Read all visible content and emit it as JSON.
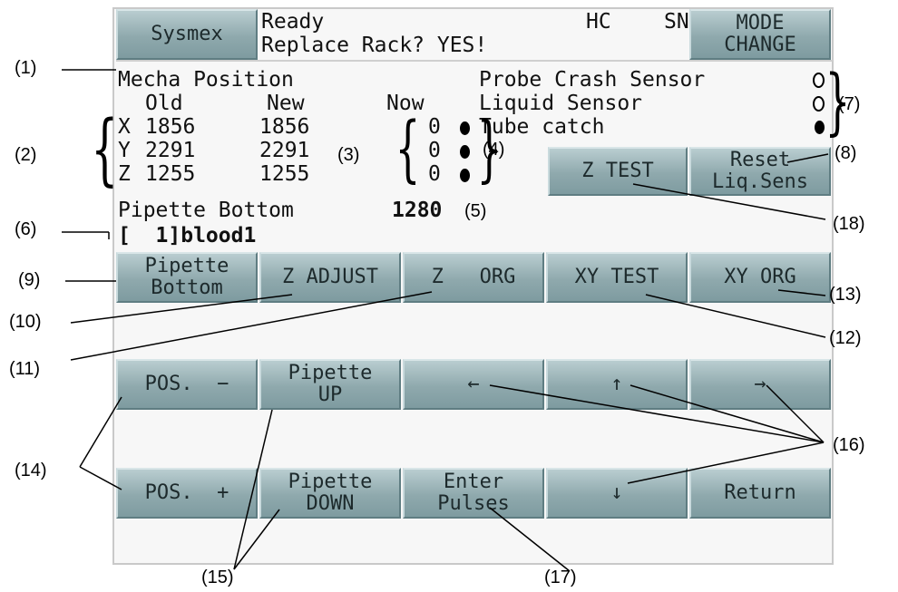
{
  "header": {
    "brand_button": "Sysmex",
    "status_line1": "Ready",
    "status_line2": "Replace Rack? YES!",
    "hc": "HC",
    "sn": "SN",
    "mode_change_line1": "MODE",
    "mode_change_line2": "CHANGE"
  },
  "info": {
    "title": "Mecha Position",
    "col_old": "Old",
    "col_new": "New",
    "col_now": "Now",
    "rows": [
      {
        "axis": "X",
        "old": "1856",
        "new": "1856",
        "now": "0"
      },
      {
        "axis": "Y",
        "old": "2291",
        "new": "2291",
        "now": "0"
      },
      {
        "axis": "Z",
        "old": "1255",
        "new": "1255",
        "now": "0"
      }
    ],
    "sensors": [
      {
        "label": "Probe Crash Sensor",
        "state": "off"
      },
      {
        "label": "Liquid Sensor",
        "state": "off"
      },
      {
        "label": "Tube catch",
        "state": "on"
      }
    ],
    "pipette_bottom_label": "Pipette Bottom",
    "pipette_bottom_value": "1280",
    "sample_label": "[  1]blood1"
  },
  "buttons": {
    "z_test": "Z TEST",
    "reset_liq_line1": "Reset",
    "reset_liq_line2": "Liq.Sens",
    "row1": [
      {
        "line1": "Pipette",
        "line2": "Bottom"
      },
      {
        "line1": "Z ADJUST",
        "line2": ""
      },
      {
        "line1": "Z   ORG",
        "line2": ""
      },
      {
        "line1": "XY TEST",
        "line2": ""
      },
      {
        "line1": "XY ORG",
        "line2": ""
      }
    ],
    "row2": [
      {
        "line1": "POS.  −",
        "line2": ""
      },
      {
        "line1": "Pipette",
        "line2": "UP"
      },
      {
        "line1": "←",
        "line2": ""
      },
      {
        "line1": "↑",
        "line2": ""
      },
      {
        "line1": "→",
        "line2": ""
      }
    ],
    "row3": [
      {
        "line1": "POS.  +",
        "line2": ""
      },
      {
        "line1": "Pipette",
        "line2": "DOWN"
      },
      {
        "line1": "Enter",
        "line2": "Pulses"
      },
      {
        "line1": "↓",
        "line2": ""
      },
      {
        "line1": "Return",
        "line2": ""
      }
    ]
  },
  "callouts": [
    "(1)",
    "(2)",
    "(3)",
    "(4)",
    "(5)",
    "(6)",
    "(7)",
    "(8)",
    "(9)",
    "(10)",
    "(11)",
    "(12)",
    "(13)",
    "(14)",
    "(15)",
    "(16)",
    "(17)",
    "(18)"
  ],
  "colors": {
    "button": "#8fa9ad",
    "screen": "#f7f7f7"
  }
}
